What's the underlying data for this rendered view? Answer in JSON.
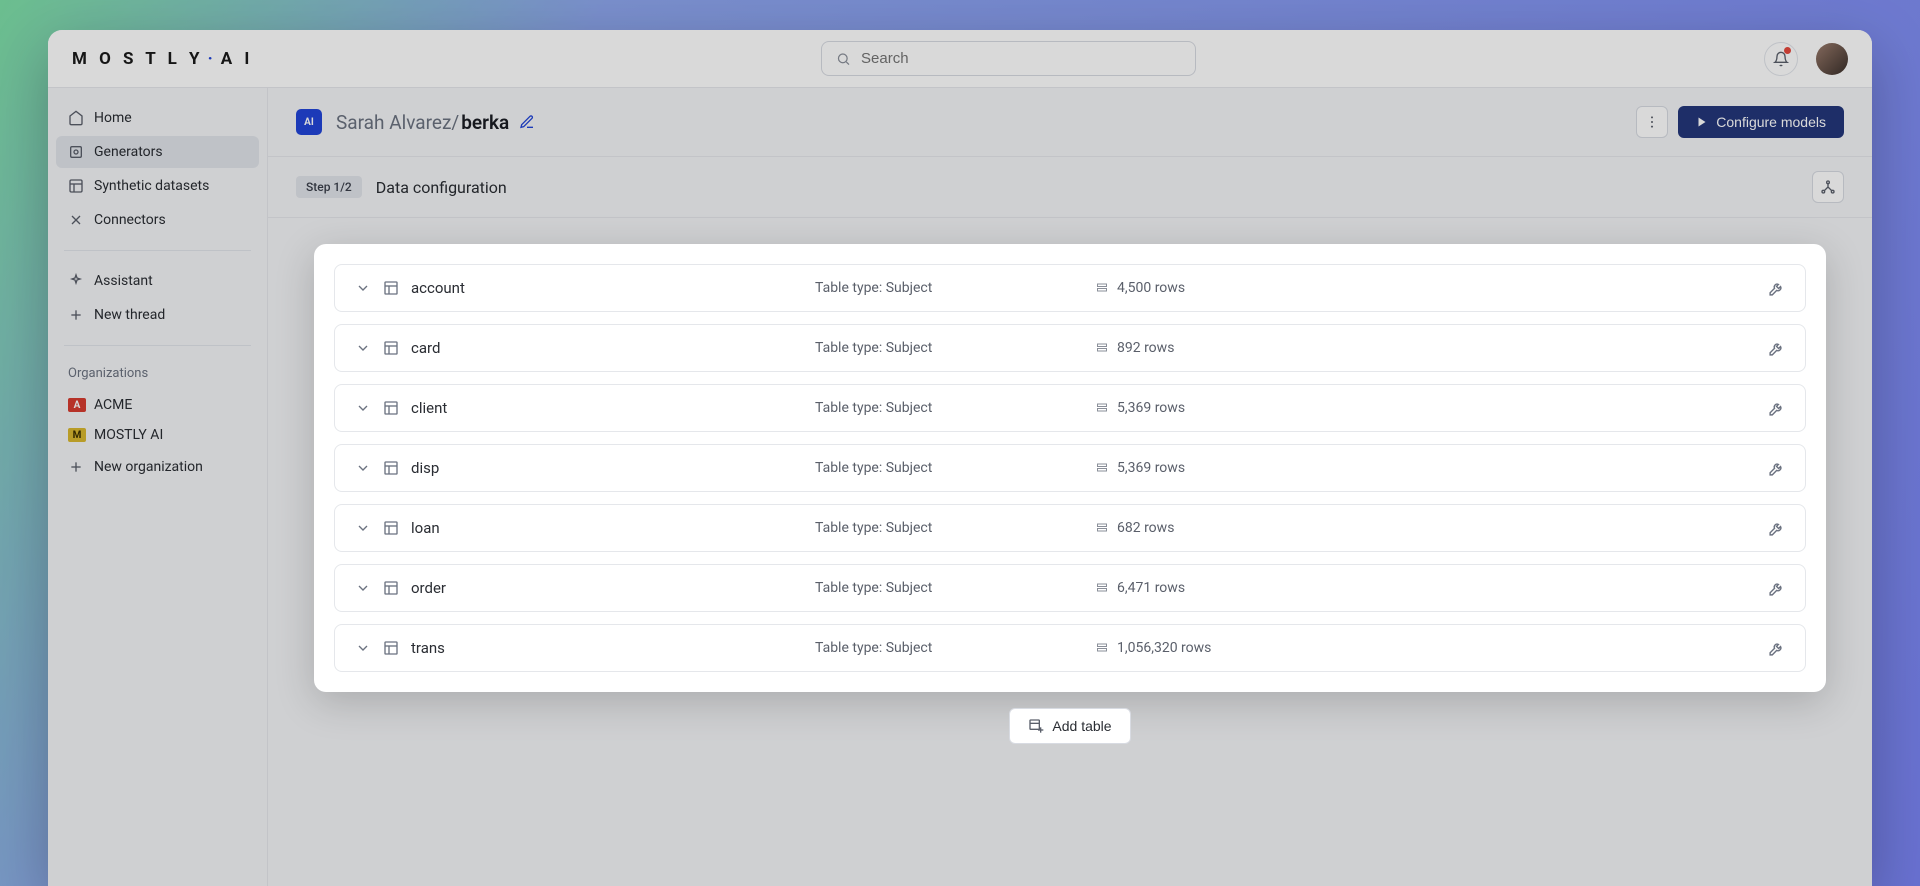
{
  "logo_text": "MOSTLY·AI",
  "search": {
    "placeholder": "Search"
  },
  "sidebar": {
    "nav": [
      {
        "label": "Home"
      },
      {
        "label": "Generators"
      },
      {
        "label": "Synthetic datasets"
      },
      {
        "label": "Connectors"
      }
    ],
    "assistant_label": "Assistant",
    "new_thread_label": "New thread",
    "organizations_label": "Organizations",
    "orgs": [
      {
        "badge": "A",
        "label": "ACME",
        "color": "#d63b2f"
      },
      {
        "badge": "M",
        "label": "MOSTLY AI",
        "color": "#d9b82f"
      }
    ],
    "new_org_label": "New organization"
  },
  "header": {
    "owner": "Sarah Alvarez/",
    "project": "berka",
    "configure_label": "Configure models"
  },
  "subheader": {
    "step": "Step 1/2",
    "title": "Data configuration"
  },
  "tables": [
    {
      "name": "account",
      "type": "Table type: Subject",
      "rows": "4,500 rows"
    },
    {
      "name": "card",
      "type": "Table type: Subject",
      "rows": "892 rows"
    },
    {
      "name": "client",
      "type": "Table type: Subject",
      "rows": "5,369 rows"
    },
    {
      "name": "disp",
      "type": "Table type: Subject",
      "rows": "5,369 rows"
    },
    {
      "name": "loan",
      "type": "Table type: Subject",
      "rows": "682 rows"
    },
    {
      "name": "order",
      "type": "Table type: Subject",
      "rows": "6,471 rows"
    },
    {
      "name": "trans",
      "type": "Table type: Subject",
      "rows": "1,056,320 rows"
    }
  ],
  "add_table_label": "Add table"
}
